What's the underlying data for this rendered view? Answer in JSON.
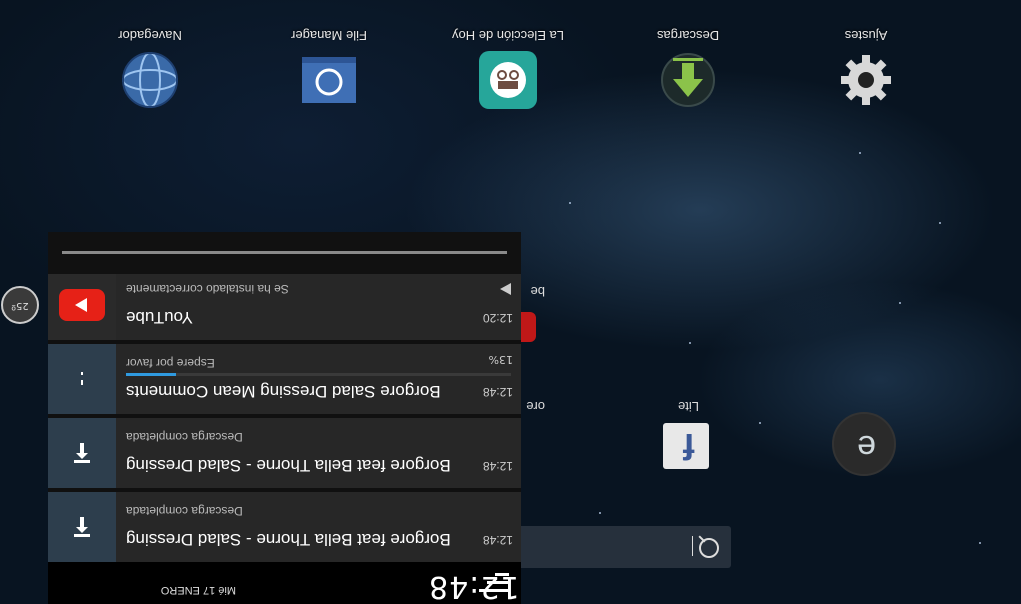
{
  "home": {
    "apps": [
      {
        "label": "Navegador",
        "icon": "globe-icon"
      },
      {
        "label": "File Manager",
        "icon": "folder-icon"
      },
      {
        "label": "La Elección de Hoy",
        "icon": "incognito-icon"
      },
      {
        "label": "Descargas",
        "icon": "download-icon"
      },
      {
        "label": "Ajustes",
        "icon": "gear-icon"
      }
    ],
    "behind_labels": {
      "youtube_partial": "be",
      "store_partial": "ore",
      "lite": "Lite"
    }
  },
  "status": {
    "time": "12:48",
    "date": "Mié 17 ENERO",
    "side_bubble": "25º"
  },
  "notifications": [
    {
      "icon": "youtube-icon",
      "title": "YouTube",
      "subtitle": "Se ha instalado correctamente",
      "time": "12:20"
    },
    {
      "icon": "download-icon",
      "title": "Borgore Salad Dressing Mean Comments",
      "subtitle": "Espere por favor",
      "time": "12:48",
      "percent": "13%",
      "progress": 0.13
    },
    {
      "icon": "download-complete-icon",
      "title": "Borgore feat Bella Thorne - Salad Dressing",
      "subtitle": "Descarga completada",
      "time": "12:48"
    },
    {
      "icon": "download-complete-icon",
      "title": "Borgore feat Bella Thorne - Salad Dressing",
      "subtitle": "Descarga completada",
      "time": "12:48"
    }
  ],
  "colors": {
    "accent": "#2f9ae0",
    "youtube": "#e62117",
    "panel": "#272727"
  }
}
